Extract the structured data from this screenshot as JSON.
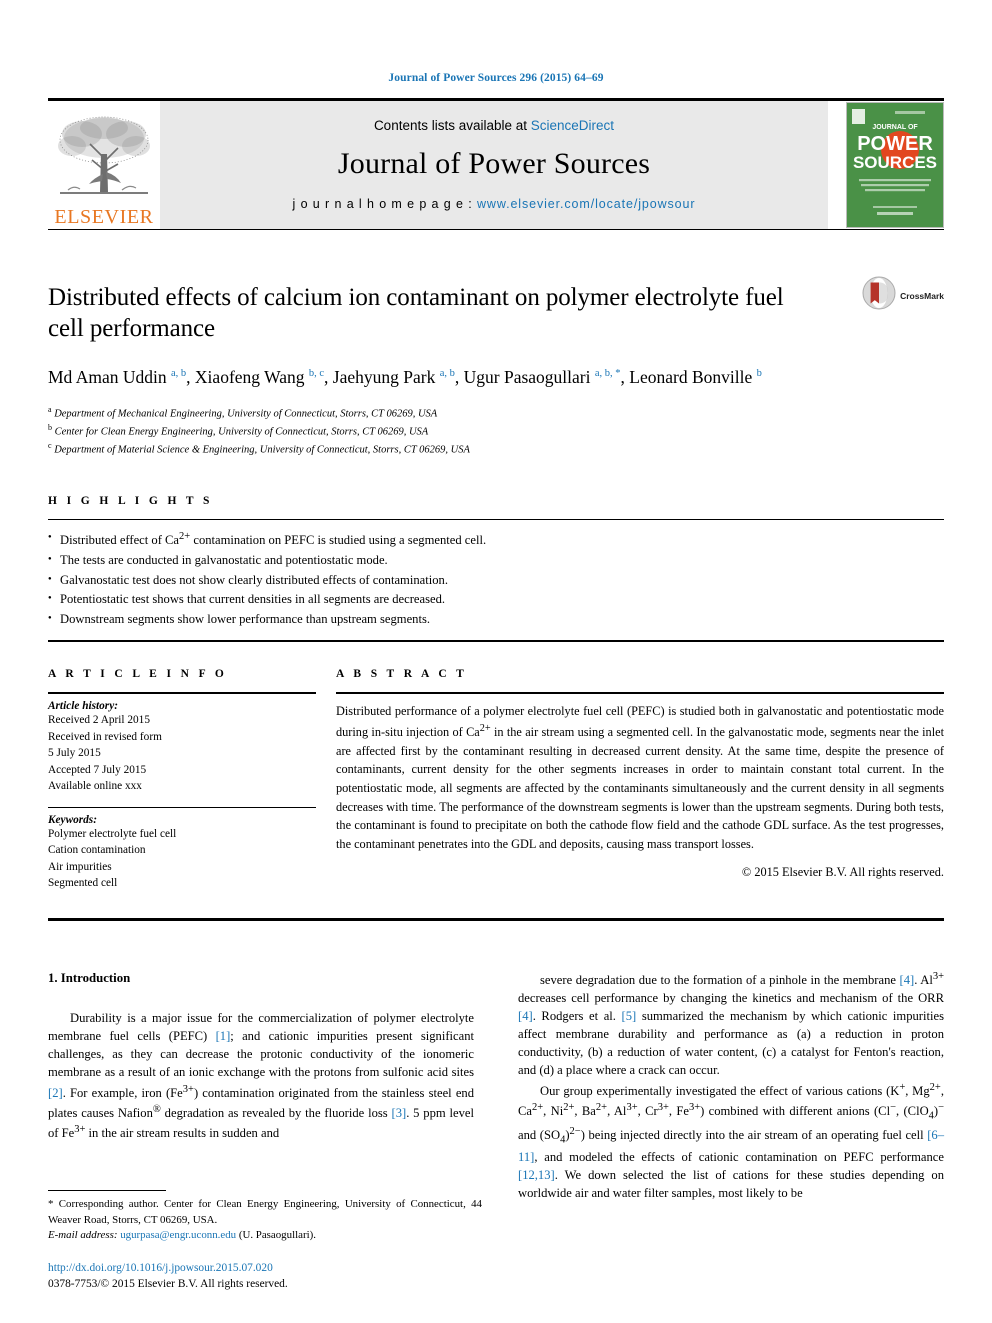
{
  "running_head": "Journal of Power Sources 296 (2015) 64–69",
  "masthead": {
    "contents_prefix": "Contents lists available at ",
    "sciencedirect": "ScienceDirect",
    "journal_name": "Journal of Power Sources",
    "homepage_label": "j o u r n a l   h o m e p a g e :  ",
    "homepage_url": "www.elsevier.com/locate/jpowsour",
    "publisher_wordmark": "ELSEVIER",
    "cover_line1": "JOURNAL OF",
    "cover_line2": "POWER",
    "cover_line3": "SOURCES"
  },
  "article": {
    "title": "Distributed effects of calcium ion contaminant on polymer electrolyte fuel cell performance",
    "crossmark_label": "CrossMark",
    "authors_html": "Md Aman Uddin <sup>a, b</sup>, Xiaofeng Wang <sup>b, c</sup>, Jaehyung Park <sup>a, b</sup>, Ugur Pasaogullari <sup>a, b, *</sup>, Leonard Bonville <sup>b</sup>",
    "affiliations": [
      "Department of Mechanical Engineering, University of Connecticut, Storrs, CT 06269, USA",
      "Center for Clean Energy Engineering, University of Connecticut, Storrs, CT 06269, USA",
      "Department of Material Science & Engineering, University of Connecticut, Storrs, CT 06269, USA"
    ],
    "affiliation_marks": [
      "a",
      "b",
      "c"
    ]
  },
  "highlights": {
    "heading": "H I G H L I G H T S",
    "items_html": [
      "Distributed effect of Ca<sup>2+</sup> contamination on PEFC is studied using a segmented cell.",
      "The tests are conducted in galvanostatic and potentiostatic mode.",
      "Galvanostatic test does not show clearly distributed effects of contamination.",
      "Potentiostatic test shows that current densities in all segments are decreased.",
      "Downstream segments show lower performance than upstream segments."
    ]
  },
  "article_info": {
    "heading": "A R T I C L E   I N F O",
    "history_label": "Article history:",
    "history_lines": [
      "Received 2 April 2015",
      "Received in revised form",
      "5 July 2015",
      "Accepted 7 July 2015",
      "Available online xxx"
    ],
    "keywords_label": "Keywords:",
    "keywords": [
      "Polymer electrolyte fuel cell",
      "Cation contamination",
      "Air impurities",
      "Segmented cell"
    ]
  },
  "abstract": {
    "heading": "A B S T R A C T",
    "text_html": "Distributed performance of a polymer electrolyte fuel cell (PEFC) is studied both in galvanostatic and potentiostatic mode during in-situ injection of Ca<sup>2+</sup> in the air stream using a segmented cell. In the galvanostatic mode, segments near the inlet are affected first by the contaminant resulting in decreased current density. At the same time, despite the presence of contaminants, current density for the other segments increases in order to maintain constant total current. In the potentiostatic mode, all segments are affected by the contaminants simultaneously and the current density in all segments decreases with time. The performance of the downstream segments is lower than the upstream segments. During both tests, the contaminant is found to precipitate on both the cathode flow field and the cathode GDL surface. As the test progresses, the contaminant penetrates into the GDL and deposits, causing mass transport losses.",
    "copyright": "© 2015 Elsevier B.V. All rights reserved."
  },
  "body": {
    "section_heading": "1. Introduction",
    "left_paragraph_html": "Durability is a major issue for the commercialization of polymer electrolyte membrane fuel cells (PEFC) <span class=\"ref\">[1]</span>; and cationic impurities present significant challenges, as they can decrease the protonic conductivity of the ionomeric membrane as a result of an ionic exchange with the protons from sulfonic acid sites <span class=\"ref\">[2]</span>. For example, iron (Fe<sup>3+</sup>) contamination originated from the stainless steel end plates causes Nafion<sup>®</sup> degradation as revealed by the fluoride loss <span class=\"ref\">[3]</span>. 5 ppm level of Fe<sup>3+</sup> in the air stream results in sudden and",
    "right_paragraph1_html": "severe degradation due to the formation of a pinhole in the membrane <span class=\"ref\">[4]</span>. Al<sup>3+</sup> decreases cell performance by changing the kinetics and mechanism of the ORR <span class=\"ref\">[4]</span>. Rodgers et al. <span class=\"ref\">[5]</span> summarized the mechanism by which cationic impurities affect membrane durability and performance as (a) a reduction in proton conductivity, (b) a reduction of water content, (c) a catalyst for Fenton's reaction, and (d) a place where a crack can occur.",
    "right_paragraph2_html": "Our group experimentally investigated the effect of various cations (K<sup>+</sup>, Mg<sup>2+</sup>, Ca<sup>2+</sup>, Ni<sup>2+</sup>, Ba<sup>2+</sup>, Al<sup>3+</sup>, Cr<sup>3+</sup>, Fe<sup>3+</sup>) combined with different anions (Cl<sup>&minus;</sup>, (ClO<sub>4</sub>)<sup>&minus;</sup> and (SO<sub>4</sub>)<sup>2&minus;</sup>) being injected directly into the air stream of an operating fuel cell <span class=\"ref\">[6&ndash;11]</span>, and modeled the effects of cationic contamination on PEFC performance <span class=\"ref\">[12,13]</span>. We down selected the list of cations for these studies depending on worldwide air and water filter samples, most likely to be"
  },
  "footnote": {
    "corresponding_html": "<span class=\"star\">*</span> Corresponding author. Center for Clean Energy Engineering, University of Connecticut, 44 Weaver Road, Storrs, CT 06269, USA.",
    "email_html": "<em>E-mail address:</em> <a href=\"#\">ugurpasa@engr.uconn.edu</a> (U. Pasaogullari).",
    "doi": "http://dx.doi.org/10.1016/j.jpowsour.2015.07.020",
    "issn_line": "0378-7753/© 2015 Elsevier B.V. All rights reserved."
  },
  "colors": {
    "link_blue": "#1a75b5",
    "elsevier_orange": "#e87722",
    "cover_green": "#4a9147",
    "crossmark_red": "#b5332a"
  }
}
